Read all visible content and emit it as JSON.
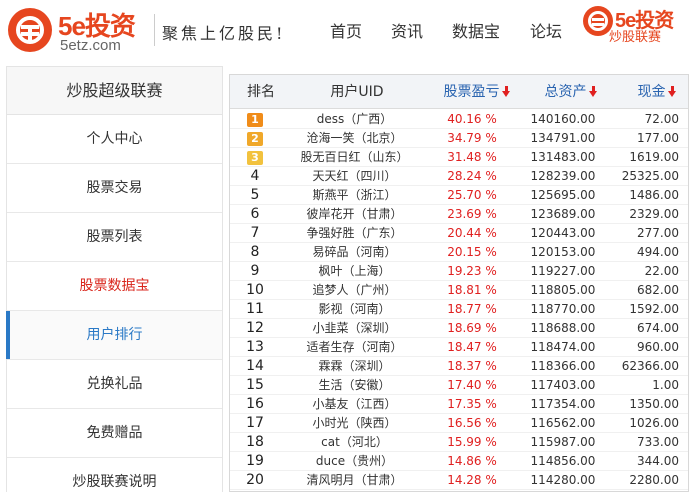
{
  "header": {
    "logo_text": "5e投资",
    "logo_sub": "5etz.com",
    "slogan": "聚焦上亿股民!",
    "nav": [
      "首页",
      "资讯",
      "数据宝",
      "论坛"
    ],
    "logo2_text": "5e投资",
    "logo2_sub": "炒股联赛"
  },
  "sidebar": {
    "title": "炒股超级联赛",
    "items": [
      {
        "label": "个人中心"
      },
      {
        "label": "股票交易"
      },
      {
        "label": "股票列表"
      },
      {
        "label": "股票数据宝"
      },
      {
        "label": "用户排行"
      },
      {
        "label": "兑换礼品"
      },
      {
        "label": "免费赠品"
      },
      {
        "label": "炒股联赛说明"
      }
    ],
    "highlight_color": "#d9261c",
    "active_color": "#2a79c6"
  },
  "table": {
    "columns": [
      "排名",
      "用户UID",
      "股票盈亏",
      "总资产",
      "现金"
    ],
    "rows": [
      {
        "rank": "1",
        "uid": "dess（广西）",
        "profit": "40.16 %",
        "assets": "140160.00",
        "cash": "72.00"
      },
      {
        "rank": "2",
        "uid": "沧海一笑（北京）",
        "profit": "34.79 %",
        "assets": "134791.00",
        "cash": "177.00"
      },
      {
        "rank": "3",
        "uid": "股无百日红（山东）",
        "profit": "31.48 %",
        "assets": "131483.00",
        "cash": "1619.00"
      },
      {
        "rank": "4",
        "uid": "天天红（四川）",
        "profit": "28.24 %",
        "assets": "128239.00",
        "cash": "25325.00"
      },
      {
        "rank": "5",
        "uid": "斯燕平（浙江）",
        "profit": "25.70 %",
        "assets": "125695.00",
        "cash": "1486.00"
      },
      {
        "rank": "6",
        "uid": "彼岸花开（甘肃）",
        "profit": "23.69 %",
        "assets": "123689.00",
        "cash": "2329.00"
      },
      {
        "rank": "7",
        "uid": "争强好胜（广东）",
        "profit": "20.44 %",
        "assets": "120443.00",
        "cash": "277.00"
      },
      {
        "rank": "8",
        "uid": "易碎品（河南）",
        "profit": "20.15 %",
        "assets": "120153.00",
        "cash": "494.00"
      },
      {
        "rank": "9",
        "uid": "枫叶（上海）",
        "profit": "19.23 %",
        "assets": "119227.00",
        "cash": "22.00"
      },
      {
        "rank": "10",
        "uid": "追梦人（广州）",
        "profit": "18.81 %",
        "assets": "118805.00",
        "cash": "682.00"
      },
      {
        "rank": "11",
        "uid": "影视（河南）",
        "profit": "18.77 %",
        "assets": "118770.00",
        "cash": "1592.00"
      },
      {
        "rank": "12",
        "uid": "小韭菜（深圳）",
        "profit": "18.69 %",
        "assets": "118688.00",
        "cash": "674.00"
      },
      {
        "rank": "13",
        "uid": "适者生存（河南）",
        "profit": "18.47 %",
        "assets": "118474.00",
        "cash": "960.00"
      },
      {
        "rank": "14",
        "uid": "霖霖（深圳）",
        "profit": "18.37 %",
        "assets": "118366.00",
        "cash": "62366.00"
      },
      {
        "rank": "15",
        "uid": "生活（安徽）",
        "profit": "17.40 %",
        "assets": "117403.00",
        "cash": "1.00"
      },
      {
        "rank": "16",
        "uid": "小基友（江西）",
        "profit": "17.35 %",
        "assets": "117354.00",
        "cash": "1350.00"
      },
      {
        "rank": "17",
        "uid": "小时光（陕西）",
        "profit": "16.56 %",
        "assets": "116562.00",
        "cash": "1026.00"
      },
      {
        "rank": "18",
        "uid": "cat（河北）",
        "profit": "15.99 %",
        "assets": "115987.00",
        "cash": "733.00"
      },
      {
        "rank": "19",
        "uid": "duce（贵州）",
        "profit": "14.86 %",
        "assets": "114856.00",
        "cash": "344.00"
      },
      {
        "rank": "20",
        "uid": "清风明月（甘肃）",
        "profit": "14.28 %",
        "assets": "114280.00",
        "cash": "2280.00"
      }
    ],
    "profit_color": "#e02020",
    "sort_icon": "arrow-down-icon"
  }
}
